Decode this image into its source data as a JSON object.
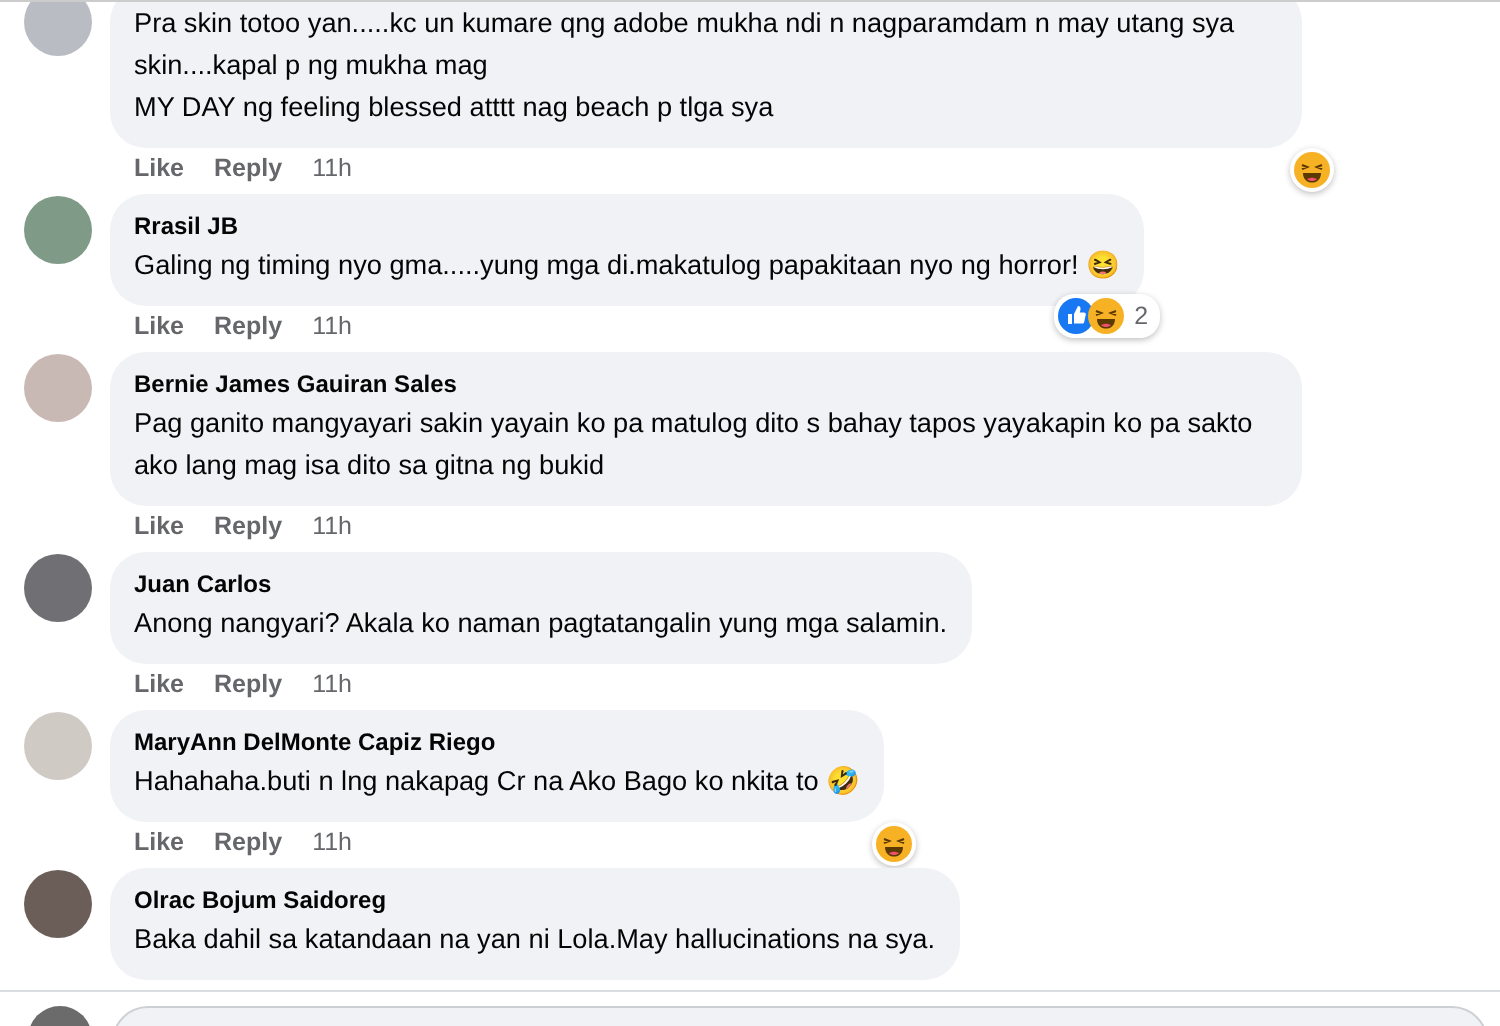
{
  "comments": [
    {
      "lines": [
        "Pra skin totoo yan.....kc un kumare qng adobe mukha ndi n nagparamdam n may utang sya skin....kapal p ng mukha mag",
        "MY DAY ng feeling blessed atttt nag beach p tlga sya"
      ],
      "actions": [
        "Like",
        "Reply",
        "11h"
      ],
      "reactions": [
        {
          "kind": "haha"
        }
      ]
    },
    {
      "author": "Rrasil JB",
      "lines": [
        "Galing ng timing nyo gma.....yung mga di.makatulog papakitaan nyo ng horror! 😆"
      ],
      "actions": [
        "Like",
        "Reply",
        "11h"
      ],
      "reactions": [
        {
          "kind": "like"
        },
        {
          "kind": "haha"
        }
      ],
      "reaction_count": "2"
    },
    {
      "author": "Bernie James Gauiran Sales",
      "lines": [
        "Pag ganito mangyayari sakin yayain ko pa matulog dito s bahay tapos yayakapin ko pa sakto ako lang mag isa dito sa gitna ng bukid"
      ],
      "actions": [
        "Like",
        "Reply",
        "11h"
      ]
    },
    {
      "author": "Juan Carlos",
      "lines": [
        "Anong nangyari? Akala ko naman pagtatangalin yung mga salamin."
      ],
      "actions": [
        "Like",
        "Reply",
        "11h"
      ]
    },
    {
      "author": "MaryAnn DelMonte Capiz Riego",
      "lines": [
        "Hahahaha.buti n lng nakapag Cr na Ako Bago ko nkita to 🤣"
      ],
      "actions": [
        "Like",
        "Reply",
        "11h"
      ],
      "reactions": [
        {
          "kind": "haha"
        }
      ]
    },
    {
      "author": "Olrac Bojum Saidoreg",
      "lines": [
        "Baka dahil sa katandaan na yan ni Lola.May hallucinations na sya."
      ]
    }
  ]
}
